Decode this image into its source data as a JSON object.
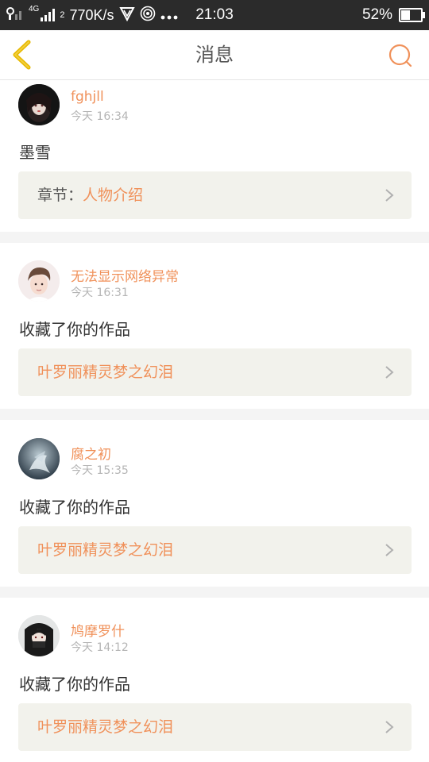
{
  "status_bar": {
    "network_speed": "770K/s",
    "network_type": "4G",
    "time": "21:03",
    "battery_percent": "52%",
    "battery_level": 0.52,
    "more_icon": "ellipsis-icon"
  },
  "nav": {
    "title": "消息",
    "back_icon": "chevron-left-icon",
    "search_icon": "search-icon"
  },
  "colors": {
    "accent": "#f0915a",
    "nav_back": "#e6b800",
    "ref_bg": "#f2f2ec"
  },
  "messages": [
    {
      "username": "fghjll",
      "time": "今天 16:34",
      "action": "墨雪",
      "ref_prefix": "章节：",
      "ref_text": "人物介绍"
    },
    {
      "username": "无法显示网络异常",
      "time": "今天 16:31",
      "action": "收藏了你的作品",
      "ref_prefix": "",
      "ref_text": "叶罗丽精灵梦之幻泪"
    },
    {
      "username": "腐之初",
      "time": "今天 15:35",
      "action": "收藏了你的作品",
      "ref_prefix": "",
      "ref_text": "叶罗丽精灵梦之幻泪"
    },
    {
      "username": "鸠摩罗什",
      "time": "今天 14:12",
      "action": "收藏了你的作品",
      "ref_prefix": "",
      "ref_text": "叶罗丽精灵梦之幻泪"
    }
  ]
}
